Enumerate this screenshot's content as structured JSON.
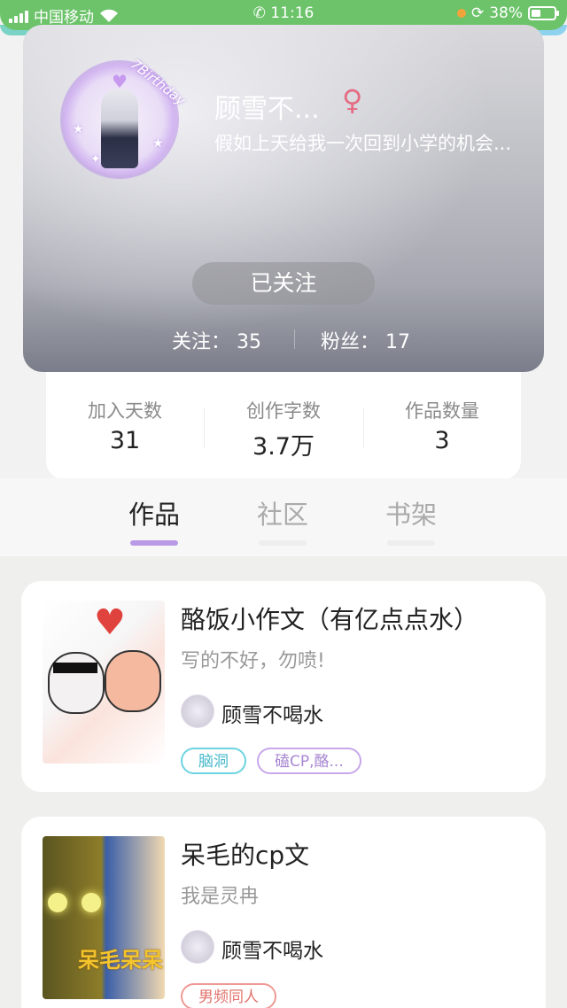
{
  "status_bar": {
    "carrier": "中国移动",
    "time": "11:16",
    "battery": "38%",
    "battery_level": 0.38
  },
  "profile": {
    "avatar_caption": "7Birthday",
    "username": "顾雪不...",
    "gender_symbol": "♀",
    "bio": "假如上天给我一次回到小学的机会...",
    "follow_button": "已关注",
    "following": "关注： 35",
    "followers": "粉丝： 17"
  },
  "stats": [
    {
      "label": "加入天数",
      "value": "31"
    },
    {
      "label": "创作字数",
      "value": "3.7万"
    },
    {
      "label": "作品数量",
      "value": "3"
    }
  ],
  "tabs": [
    {
      "label": "作品",
      "active": true
    },
    {
      "label": "社区",
      "active": false
    },
    {
      "label": "书架",
      "active": false
    }
  ],
  "works": [
    {
      "title": "酪饭小作文（有亿点点水）",
      "desc": "写的不好，勿喷!",
      "author": "顾雪不喝水",
      "tags": [
        "脑洞",
        "磕CP,酪..."
      ]
    },
    {
      "title": "呆毛的cp文",
      "desc": "我是灵冉",
      "author": "顾雪不喝水",
      "tags": [
        "男频同人"
      ],
      "cover_text": "呆毛呆呆"
    }
  ],
  "colors": {
    "statusbar": "#6cc36a",
    "tab_indicator": "#b89ae6",
    "gender": "#e46c83"
  }
}
